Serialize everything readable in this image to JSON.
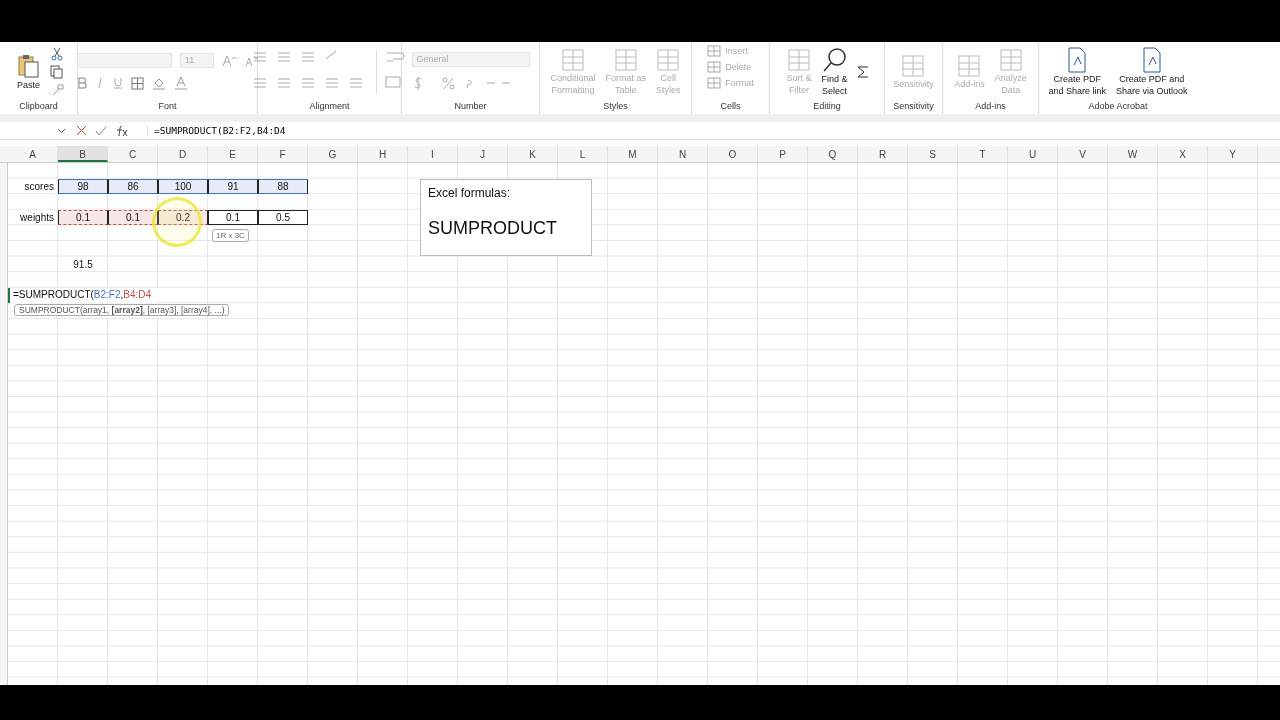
{
  "ribbon": {
    "groups": [
      {
        "kind": "clipboard",
        "label": "Clipboard",
        "buttons": [
          {
            "label": [
              "Paste"
            ],
            "disabled": false
          }
        ]
      },
      {
        "kind": "font",
        "label": "Font",
        "fields": [
          "11"
        ]
      },
      {
        "kind": "alignment",
        "label": "Alignment"
      },
      {
        "kind": "number",
        "label": "Number",
        "fields": [
          "General"
        ]
      },
      {
        "kind": "styles",
        "label": "Styles",
        "buttons": [
          {
            "label": [
              "Conditional",
              "Formatting"
            ],
            "disabled": true
          },
          {
            "label": [
              "Format as",
              "Table"
            ],
            "disabled": true
          },
          {
            "label": [
              "Cell",
              "Styles"
            ],
            "disabled": true
          }
        ]
      },
      {
        "kind": "cells",
        "label": "Cells",
        "buttons": [
          {
            "label": [
              "Insert"
            ],
            "disabled": true
          },
          {
            "label": [
              "Delete"
            ],
            "disabled": true
          },
          {
            "label": [
              "Format"
            ],
            "disabled": true
          }
        ]
      },
      {
        "kind": "editing",
        "label": "Editing",
        "buttons": [
          {
            "label": [
              "Sort &",
              "Filter"
            ],
            "disabled": true
          },
          {
            "label": [
              "Find &",
              "Select"
            ],
            "disabled": false
          }
        ]
      },
      {
        "kind": "sensitivity",
        "label": "Sensitivity",
        "buttons": [
          {
            "label": [
              "Sensitivity"
            ],
            "disabled": true
          }
        ]
      },
      {
        "kind": "addins",
        "label": "Add-ins",
        "buttons": [
          {
            "label": [
              "Add-ins"
            ],
            "disabled": true
          },
          {
            "label": [
              "Analyze",
              "Data"
            ],
            "disabled": true
          }
        ]
      },
      {
        "kind": "acrobat",
        "label": "Adobe Acrobat",
        "buttons": [
          {
            "label": [
              "Create PDF",
              "and Share link"
            ],
            "disabled": false
          },
          {
            "label": [
              "Create PDF and",
              "Share via Outlook"
            ],
            "disabled": false
          }
        ]
      }
    ]
  },
  "formula_bar": {
    "formula": "=SUMPRODUCT(B2:F2,B4:D4"
  },
  "sheet": {
    "columns": [
      {
        "label": "A",
        "selected": false
      },
      {
        "label": "B",
        "selected": true
      },
      {
        "label": "C",
        "selected": false
      },
      {
        "label": "D",
        "selected": false
      },
      {
        "label": "E",
        "selected": false
      },
      {
        "label": "F",
        "selected": false
      },
      {
        "label": "G",
        "selected": false
      },
      {
        "label": "H",
        "selected": false
      },
      {
        "label": "I",
        "selected": false
      },
      {
        "label": "J",
        "selected": false
      },
      {
        "label": "K",
        "selected": false
      },
      {
        "label": "L",
        "selected": false
      },
      {
        "label": "M",
        "selected": false
      },
      {
        "label": "N",
        "selected": false
      },
      {
        "label": "O",
        "selected": false
      },
      {
        "label": "P",
        "selected": false
      },
      {
        "label": "Q",
        "selected": false
      },
      {
        "label": "R",
        "selected": false
      },
      {
        "label": "S",
        "selected": false
      },
      {
        "label": "T",
        "selected": false
      },
      {
        "label": "U",
        "selected": false
      },
      {
        "label": "V",
        "selected": false
      },
      {
        "label": "W",
        "selected": false
      },
      {
        "label": "X",
        "selected": false
      },
      {
        "label": "Y",
        "selected": false
      }
    ],
    "rows": [
      {
        "kind": "data",
        "cells": []
      },
      {
        "kind": "data",
        "cells": [
          {
            "text": "scores",
            "bordered": false
          },
          {
            "text": "98",
            "color": "#4472c4",
            "bordered": true
          },
          {
            "text": "86",
            "color": "#4472c4",
            "bordered": true
          },
          {
            "text": "100",
            "color": "#4472c4",
            "bordered": true
          },
          {
            "text": "91",
            "color": "#4472c4",
            "bordered": true
          },
          {
            "text": "88",
            "color": "#4472c4",
            "bordered": true
          }
        ]
      },
      {
        "kind": "data",
        "cells": []
      },
      {
        "kind": "data",
        "cells": [
          {
            "text": "weights",
            "bordered": false
          },
          {
            "text": "0.1",
            "color": "#c0504d",
            "bordered": true
          },
          {
            "text": "0.1",
            "color": "#c0504d",
            "bordered": true
          },
          {
            "text": "0.2",
            "color": "#c0504d",
            "bordered": true
          },
          {
            "text": "0.1",
            "bordered": true
          },
          {
            "text": "0.5",
            "bordered": true
          }
        ]
      },
      {
        "kind": "data",
        "cells": []
      },
      {
        "kind": "data",
        "cells": []
      },
      {
        "kind": "data",
        "cells": [
          {
            "text": ""
          },
          {
            "text": "91.5",
            "bordered": false
          }
        ]
      },
      {
        "kind": "data",
        "cells": []
      },
      {
        "kind": "editing",
        "segments": [
          {
            "text": "=SUMPRODUCT("
          },
          {
            "text": "B2:F2",
            "color": "#4472c4"
          },
          {
            "text": ","
          },
          {
            "text": "B4:D4",
            "color": "#c0504d"
          }
        ]
      }
    ],
    "function_hint": "SUMPRODUCT(array1, **[array2]**, [array3], [array4], ...)",
    "size_tip": "1R x 3C",
    "text_box": {
      "title": "Excel formulas:",
      "body": "SUMPRODUCT"
    }
  }
}
